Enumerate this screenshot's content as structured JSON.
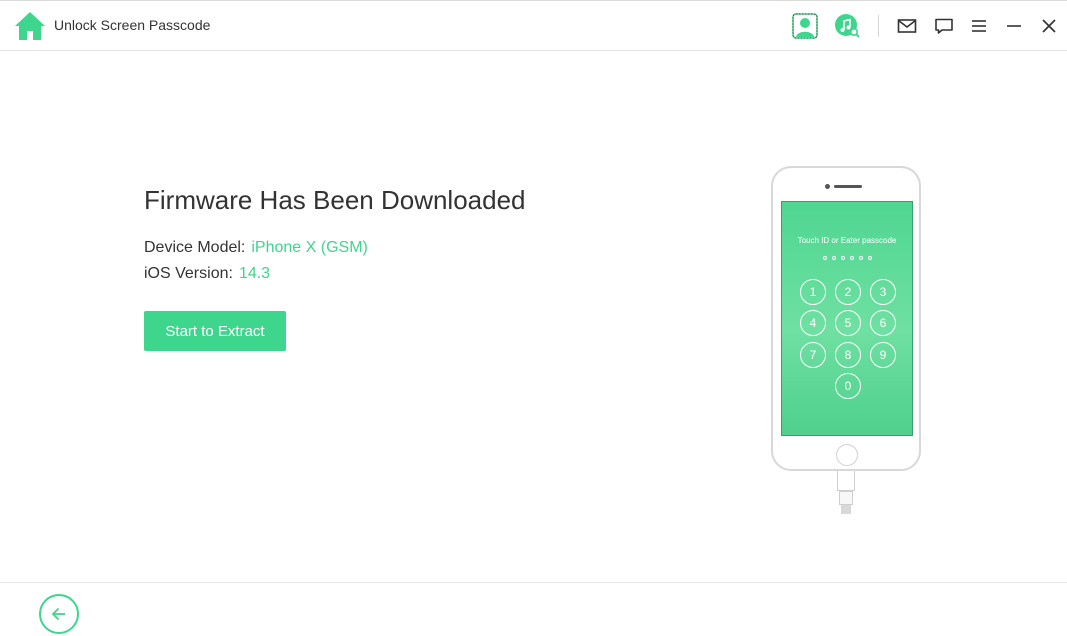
{
  "window": {
    "title": "Unlock Screen Passcode",
    "icons": [
      "home-icon",
      "account-icon",
      "music-search-icon",
      "mail-icon",
      "feedback-icon",
      "menu-icon",
      "minimize-icon",
      "close-icon"
    ]
  },
  "main": {
    "title": "Firmware Has Been Downloaded",
    "device_model_label": "Device Model:",
    "device_model_value": "iPhone X (GSM)",
    "ios_version_label": "iOS Version:",
    "ios_version_value": "14.3",
    "extract_button": "Start to Extract"
  },
  "phone": {
    "screen_text": "Touch ID or Eater passcode",
    "keys": [
      "1",
      "2",
      "3",
      "4",
      "5",
      "6",
      "7",
      "8",
      "9",
      "0"
    ]
  },
  "colors": {
    "accent": "#3dd68c",
    "text": "#333333",
    "divider": "#e6e6e6"
  }
}
